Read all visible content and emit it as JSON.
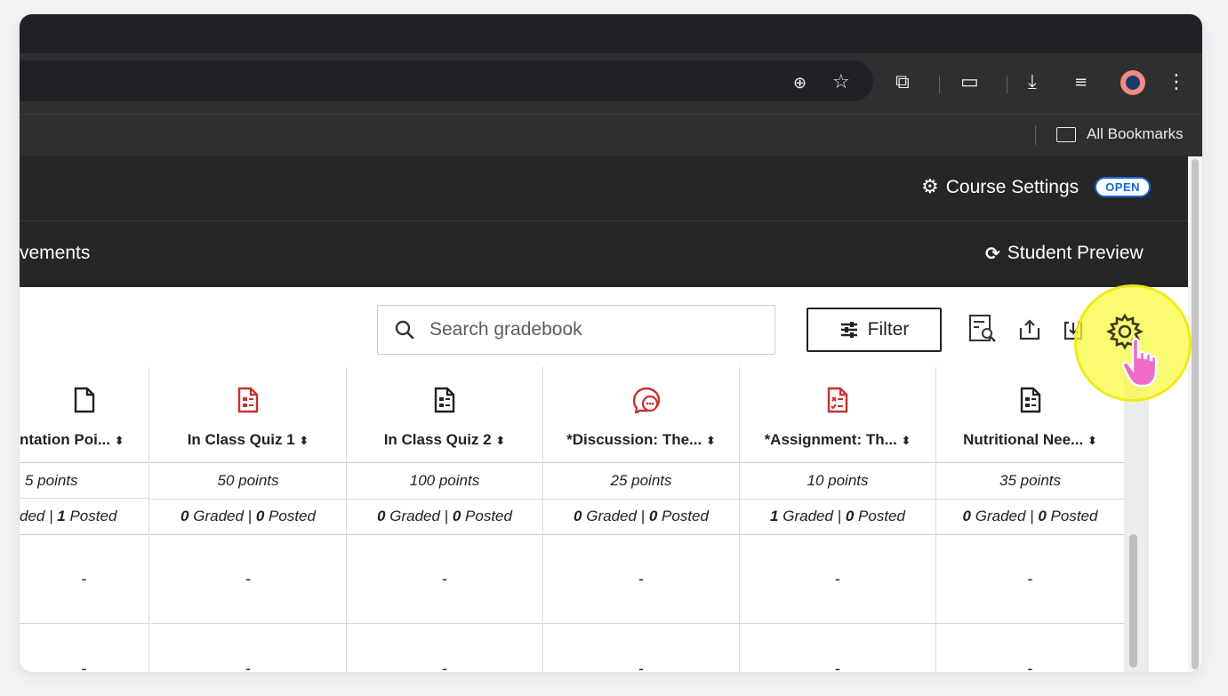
{
  "browser": {
    "bookmarks_label": "All Bookmarks"
  },
  "course_header": {
    "settings_label": "Course Settings",
    "status_badge": "OPEN"
  },
  "nav": {
    "partial_tab_label": "vements",
    "student_preview_label": "Student Preview"
  },
  "gradebook_toolbar": {
    "search_placeholder": "Search gradebook",
    "filter_label": "Filter"
  },
  "columns": [
    {
      "title": "ntation Poi...",
      "points": "5 points",
      "graded": "ded",
      "posted": "1",
      "icon": "document-icon",
      "icon_color": "#222222",
      "cell": "-"
    },
    {
      "title": "In Class Quiz 1",
      "points": "50 points",
      "graded": "0",
      "posted": "0",
      "icon": "quiz-icon",
      "icon_color": "#c6312f",
      "cell": "-"
    },
    {
      "title": "In Class Quiz 2",
      "points": "100 points",
      "graded": "0",
      "posted": "0",
      "icon": "quiz-icon",
      "icon_color": "#222222",
      "cell": "-"
    },
    {
      "title": "*Discussion: The...",
      "points": "25 points",
      "graded": "0",
      "posted": "0",
      "icon": "discussion-icon",
      "icon_color": "#c6312f",
      "cell": "-"
    },
    {
      "title": "*Assignment: Th...",
      "points": "10 points",
      "graded": "1",
      "posted": "0",
      "icon": "assignment-icon",
      "icon_color": "#c6312f",
      "cell": "-"
    },
    {
      "title": "Nutritional Nee...",
      "points": "35 points",
      "graded": "0",
      "posted": "0",
      "icon": "quiz-icon",
      "icon_color": "#222222",
      "cell": "-"
    }
  ],
  "labels": {
    "graded": "Graded",
    "posted": "Posted",
    "separator": "|"
  },
  "colors": {
    "header_bg": "#262626",
    "badge_blue": "#1565d8",
    "highlight_yellow": "#fafa3c",
    "red_icon": "#c6312f"
  }
}
